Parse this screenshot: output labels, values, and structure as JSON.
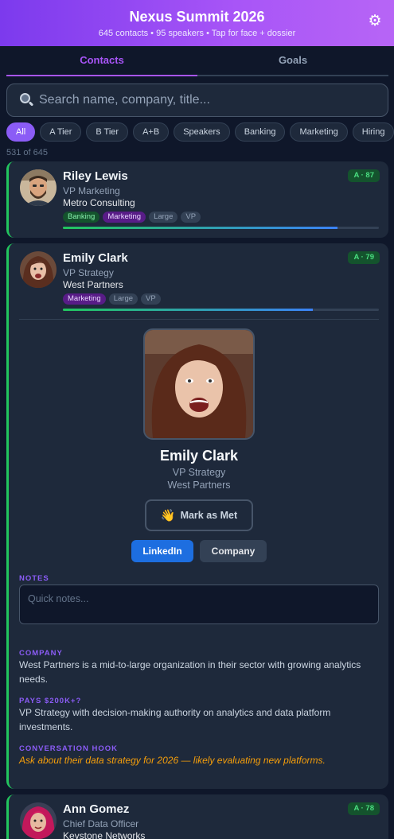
{
  "header": {
    "title": "Nexus Summit 2026",
    "subtitle": "645 contacts • 95 speakers • Tap for face + dossier",
    "settings_icon": "gear-icon"
  },
  "tabs": [
    {
      "label": "Contacts",
      "active": true
    },
    {
      "label": "Goals",
      "active": false
    }
  ],
  "search": {
    "placeholder": "Search name, company, title...",
    "value": "",
    "icon": "search-icon"
  },
  "filters": [
    "All",
    "A Tier",
    "B Tier",
    "A+B",
    "Speakers",
    "Banking",
    "Marketing",
    "Hiring"
  ],
  "active_filter": "All",
  "result_count": "531 of 645",
  "contacts": [
    {
      "name": "Riley Lewis",
      "title": "VP Marketing",
      "company": "Metro Consulting",
      "tags": [
        "Banking",
        "Marketing",
        "Large",
        "VP"
      ],
      "score_label": "A · 87",
      "score": 87
    },
    {
      "name": "Emily Clark",
      "title": "VP Strategy",
      "company": "West Partners",
      "tags": [
        "Marketing",
        "Large",
        "VP"
      ],
      "score_label": "A · 79",
      "score": 79,
      "expanded": true,
      "detail": {
        "mark_met_label": "Mark as Met",
        "mark_met_icon": "waving-hand-icon",
        "linkedin_label": "LinkedIn",
        "company_label": "Company",
        "notes_label": "NOTES",
        "notes_placeholder": "Quick notes...",
        "company_heading": "COMPANY",
        "company_text": "West Partners is a mid-to-large organization in their sector with growing analytics needs.",
        "pays_heading": "PAYS $200K+?",
        "pays_text": "VP Strategy with decision-making authority on analytics and data platform investments.",
        "hook_heading": "CONVERSATION HOOK",
        "hook_text": "Ask about their data strategy for 2026 — likely evaluating new platforms."
      }
    },
    {
      "name": "Ann Gomez",
      "title": "Chief Data Officer",
      "company": "Keystone Networks",
      "score_label": "A · 78",
      "score": 78
    }
  ],
  "colors": {
    "accent": "#8b5cf6",
    "header_gradient_start": "#7c3aed",
    "header_gradient_end": "#b765f6",
    "tier_a": "#22c55e",
    "background": "#0f172a",
    "card": "#1e293b"
  }
}
